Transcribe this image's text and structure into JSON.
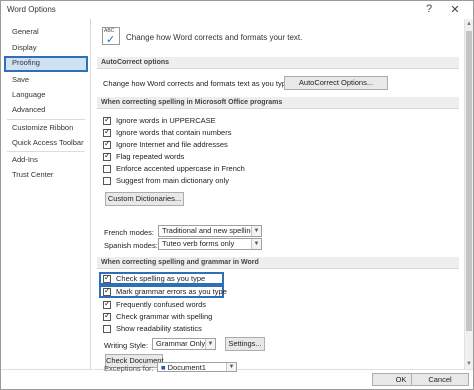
{
  "window": {
    "title": "Word Options",
    "help": "?",
    "close": "✕"
  },
  "sidebar": {
    "items": [
      {
        "label": "General"
      },
      {
        "label": "Display"
      },
      {
        "label": "Proofing"
      },
      {
        "label": "Save"
      },
      {
        "label": "Language"
      },
      {
        "label": "Advanced"
      },
      {
        "label": "Customize Ribbon"
      },
      {
        "label": "Quick Access Toolbar"
      },
      {
        "label": "Add-Ins"
      },
      {
        "label": "Trust Center"
      }
    ],
    "selected": "Proofing"
  },
  "header": {
    "icon_text": "ABC",
    "text": "Change how Word corrects and formats your text."
  },
  "autocorrect": {
    "section_title": "AutoCorrect options",
    "description": "Change how Word corrects and formats text as you type:",
    "button": "AutoCorrect Options..."
  },
  "office_spelling": {
    "section_title": "When correcting spelling in Microsoft Office programs",
    "options": [
      {
        "label": "Ignore words in UPPERCASE",
        "checked": true
      },
      {
        "label": "Ignore words that contain numbers",
        "checked": true
      },
      {
        "label": "Ignore Internet and file addresses",
        "checked": true
      },
      {
        "label": "Flag repeated words",
        "checked": true
      },
      {
        "label": "Enforce accented uppercase in French",
        "checked": false
      },
      {
        "label": "Suggest from main dictionary only",
        "checked": false
      }
    ],
    "custom_dictionaries_button": "Custom Dictionaries...",
    "french_modes_label": "French modes:",
    "french_modes_value": "Traditional and new spellings",
    "spanish_modes_label": "Spanish modes:",
    "spanish_modes_value": "Tuteo verb forms only"
  },
  "word_spelling": {
    "section_title": "When correcting spelling and grammar in Word",
    "options": [
      {
        "label": "Check spelling as you type",
        "checked": true
      },
      {
        "label": "Mark grammar errors as you type",
        "checked": true
      },
      {
        "label": "Frequently confused words",
        "checked": true
      },
      {
        "label": "Check grammar with spelling",
        "checked": true
      },
      {
        "label": "Show readability statistics",
        "checked": false
      }
    ],
    "writing_style_label": "Writing Style:",
    "writing_style_value": "Grammar Only",
    "settings_button": "Settings...",
    "check_document_button": "Check Document"
  },
  "exceptions": {
    "label": "Exceptions for:",
    "value": "Document1"
  },
  "footer": {
    "ok": "OK",
    "cancel": "Cancel"
  },
  "colors": {
    "accent": "#2f6fb7",
    "selected_bg": "#cfe2f5"
  }
}
